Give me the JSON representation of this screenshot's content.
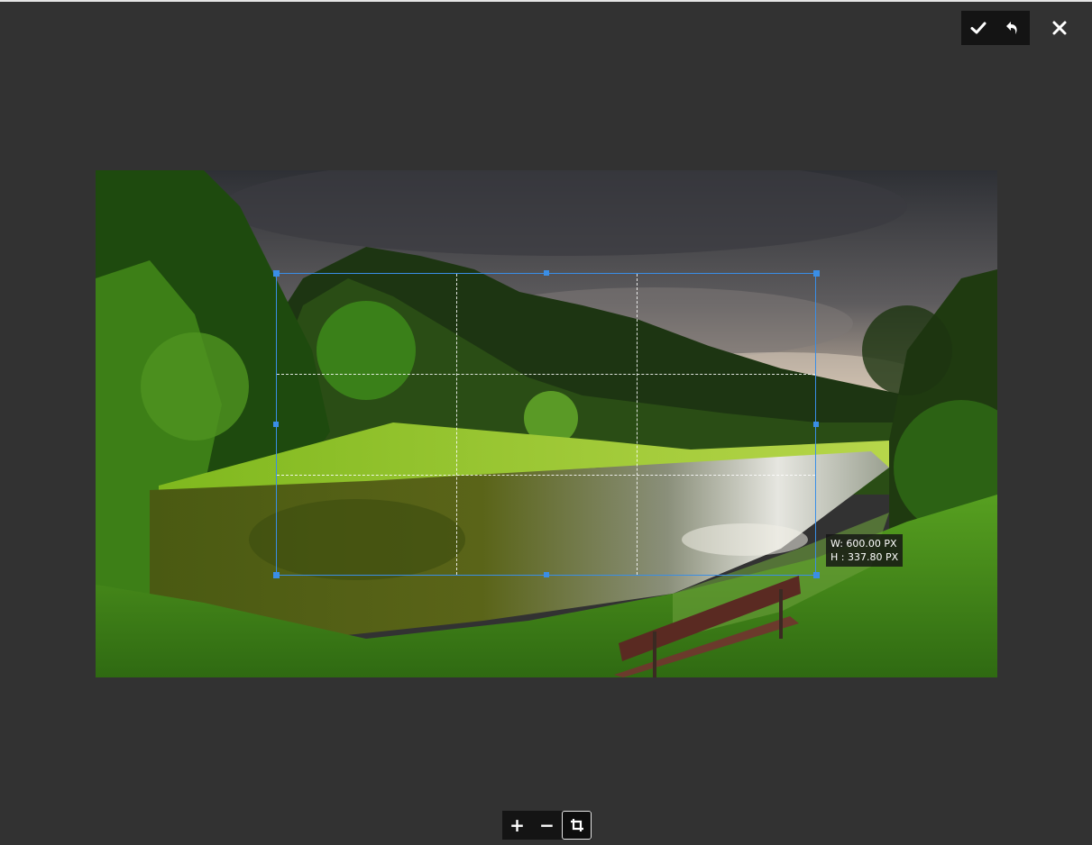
{
  "toolbar_top": {
    "confirm": {
      "icon": "check-icon"
    },
    "undo": {
      "icon": "undo-icon"
    },
    "close": {
      "icon": "close-icon"
    }
  },
  "crop": {
    "width_label": "W: 600.00 PX",
    "height_label": "H : 337.80 PX"
  },
  "toolbar_bottom": {
    "zoom_in": {
      "label": "+",
      "icon": "plus-icon"
    },
    "zoom_out": {
      "label": "−",
      "icon": "minus-icon"
    },
    "crop": {
      "icon": "crop-icon",
      "active": true
    }
  },
  "colors": {
    "background": "#323232",
    "accent": "#3a8ee6",
    "toolbar": "#141414"
  }
}
